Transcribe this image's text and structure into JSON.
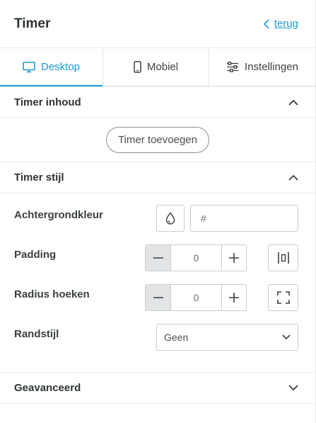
{
  "header": {
    "title": "Timer",
    "back_label": "terug"
  },
  "tabs": [
    {
      "label": "Desktop",
      "icon": "monitor-icon",
      "active": true
    },
    {
      "label": "Mobiel",
      "icon": "mobile-icon",
      "active": false
    },
    {
      "label": "Instellingen",
      "icon": "sliders-icon",
      "active": false
    }
  ],
  "sections": {
    "content": {
      "title": "Timer inhoud",
      "add_button": "Timer toevoegen",
      "expanded": true
    },
    "style": {
      "title": "Timer stijl",
      "expanded": true,
      "background": {
        "label": "Achtergrondkleur",
        "placeholder": "#"
      },
      "padding": {
        "label": "Padding",
        "value": "0"
      },
      "radius": {
        "label": "Radius hoeken",
        "value": "0"
      },
      "border": {
        "label": "Randstijl",
        "selected": "Geen"
      }
    },
    "advanced": {
      "title": "Geavanceerd",
      "expanded": false
    }
  },
  "colors": {
    "accent": "#1b9ad1",
    "text": "#2e3336",
    "border": "#c9ced2",
    "stepper_bg": "#e2e4e6"
  }
}
